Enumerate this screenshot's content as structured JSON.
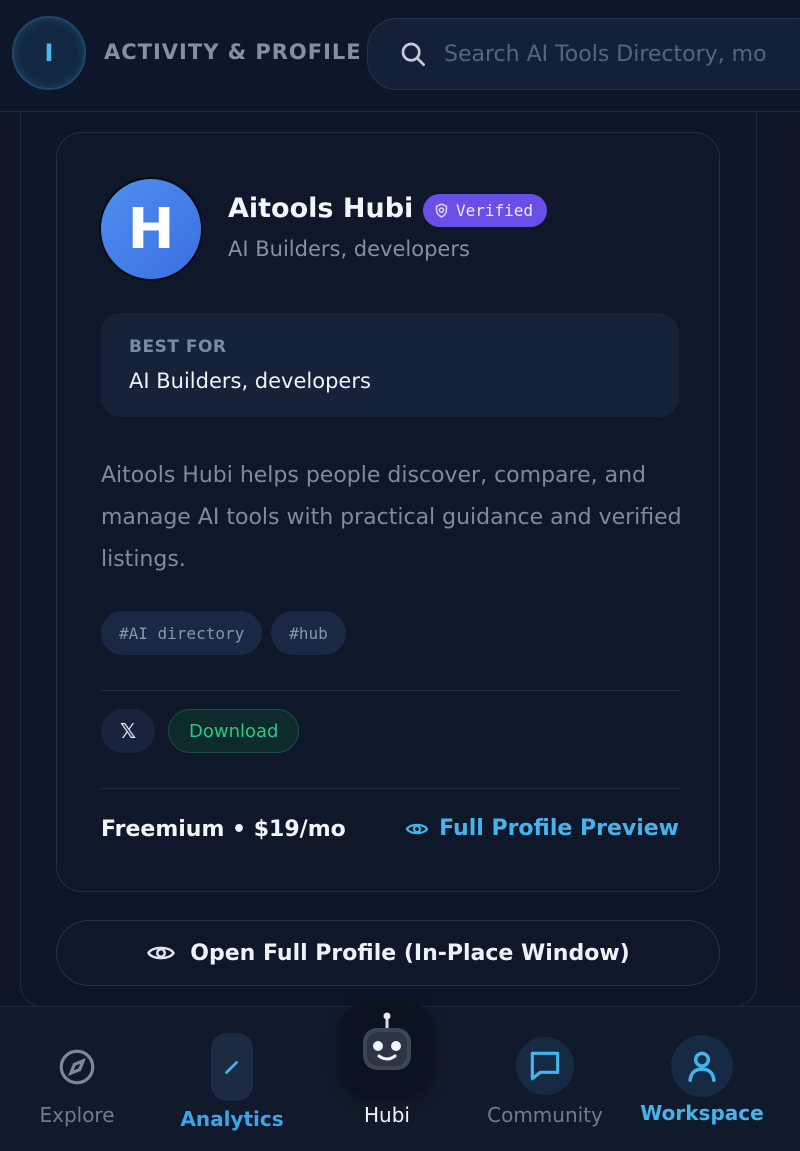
{
  "header": {
    "avatar_initial": "I",
    "title": "ACTIVITY & PROFILE",
    "search_placeholder": "Search AI Tools Directory, mo"
  },
  "profile": {
    "logo_letter": "H",
    "name": "Aitools Hubi",
    "verified_label": "Verified",
    "subtitle": "AI Builders, developers",
    "best_for_label": "BEST FOR",
    "best_for_value": "AI Builders, developers",
    "description": "Aitools Hubi helps people discover, compare, and manage AI tools with practical guidance and verified listings.",
    "tags": [
      "#AI directory",
      "#hub"
    ],
    "social_label": "𝕏",
    "download_label": "Download",
    "pricing": "Freemium • $19/mo",
    "preview_link": "Full Profile Preview"
  },
  "open_button": {
    "label": "Open Full Profile (In-Place Window)"
  },
  "bottom_nav": {
    "items": [
      {
        "label": "Explore",
        "icon": "compass-icon"
      },
      {
        "label": "Analytics",
        "icon": "pencil-icon",
        "active": true
      },
      {
        "label": "Hubi",
        "icon": "robot-icon"
      },
      {
        "label": "Community",
        "icon": "chat-bubble-icon"
      },
      {
        "label": "Workspace",
        "icon": "user-icon",
        "active": true
      }
    ]
  },
  "colors": {
    "background": "#0d1526",
    "accent": "#45b4ee",
    "verified": "#6a4fe6",
    "download": "#28c98a"
  }
}
